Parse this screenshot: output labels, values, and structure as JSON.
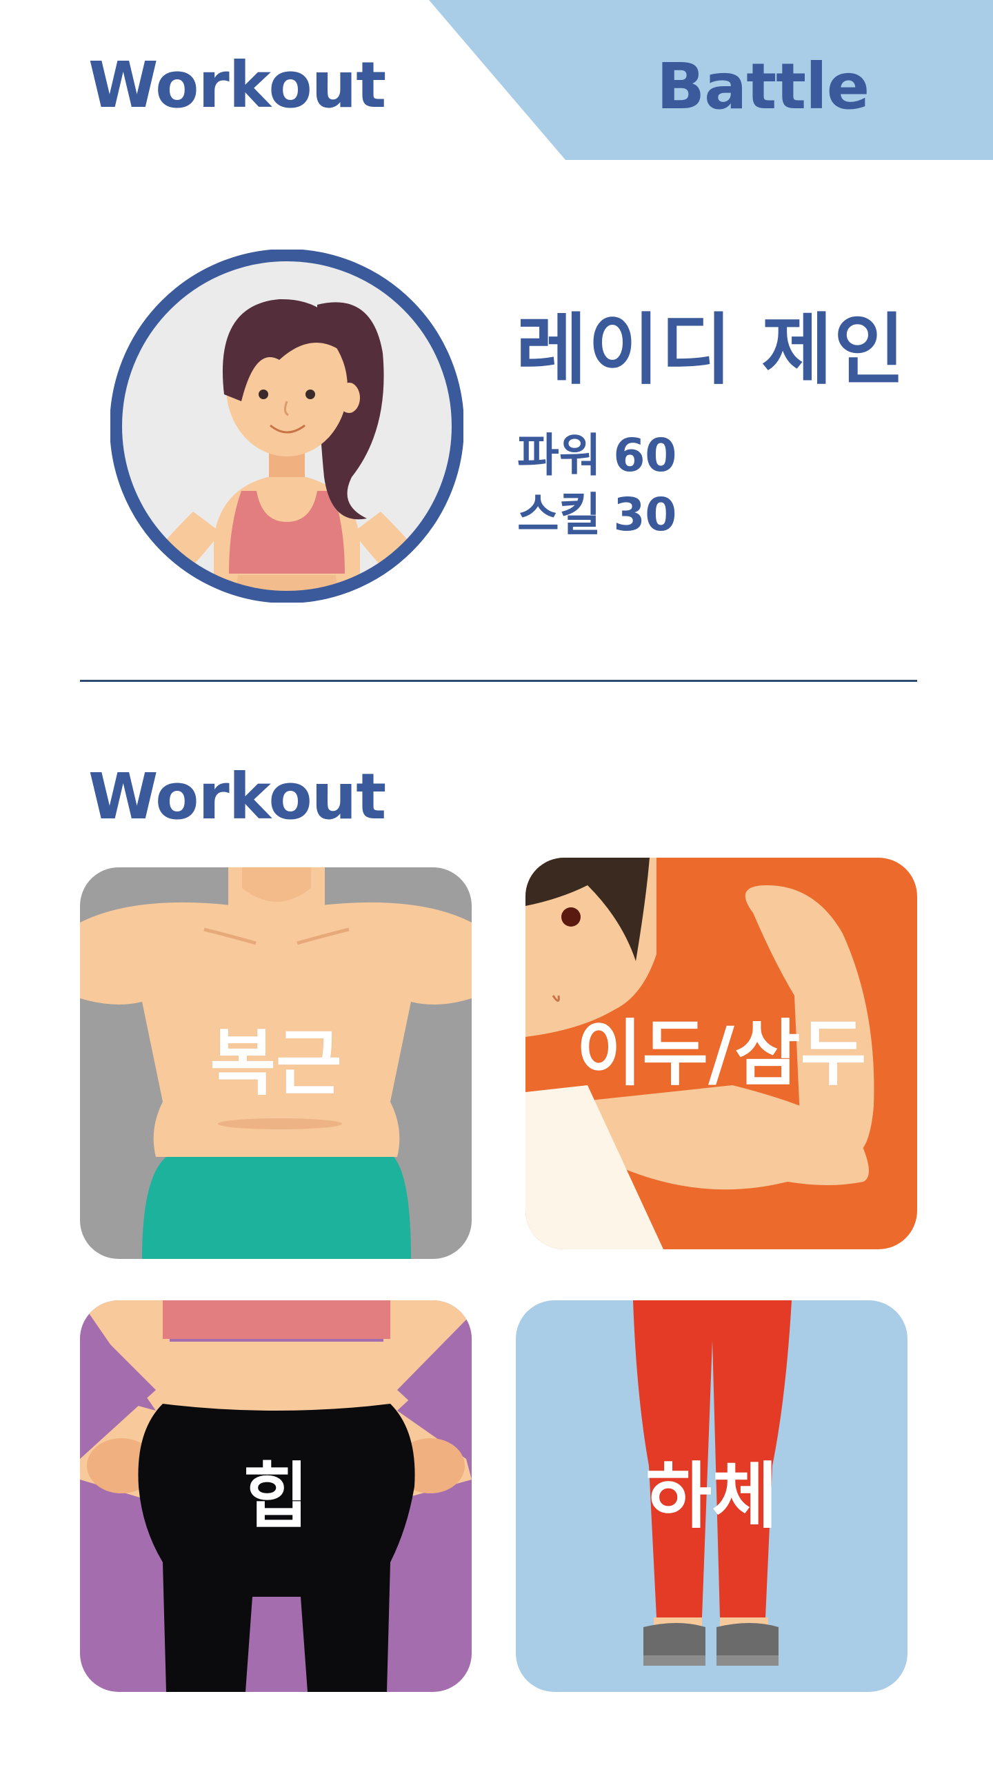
{
  "tabs": {
    "workout_label": "Workout",
    "battle_label": "Battle",
    "active": "battle"
  },
  "profile": {
    "name": "레이디 제인",
    "stats": [
      {
        "label": "파워",
        "value": "60"
      },
      {
        "label": "스킬",
        "value": "30"
      }
    ]
  },
  "section": {
    "title": "Workout"
  },
  "cards": [
    {
      "label": "복근",
      "color": "#9e9e9e"
    },
    {
      "label": "이두/삼두",
      "color": "#ec6a2b"
    },
    {
      "label": "힙",
      "color": "#a46eae"
    },
    {
      "label": "하체",
      "color": "#a9cde6"
    }
  ],
  "colors": {
    "brand_blue": "#3a5a9b",
    "battle_tab_bg": "#a9cde6",
    "divider": "#2f4a6f"
  }
}
